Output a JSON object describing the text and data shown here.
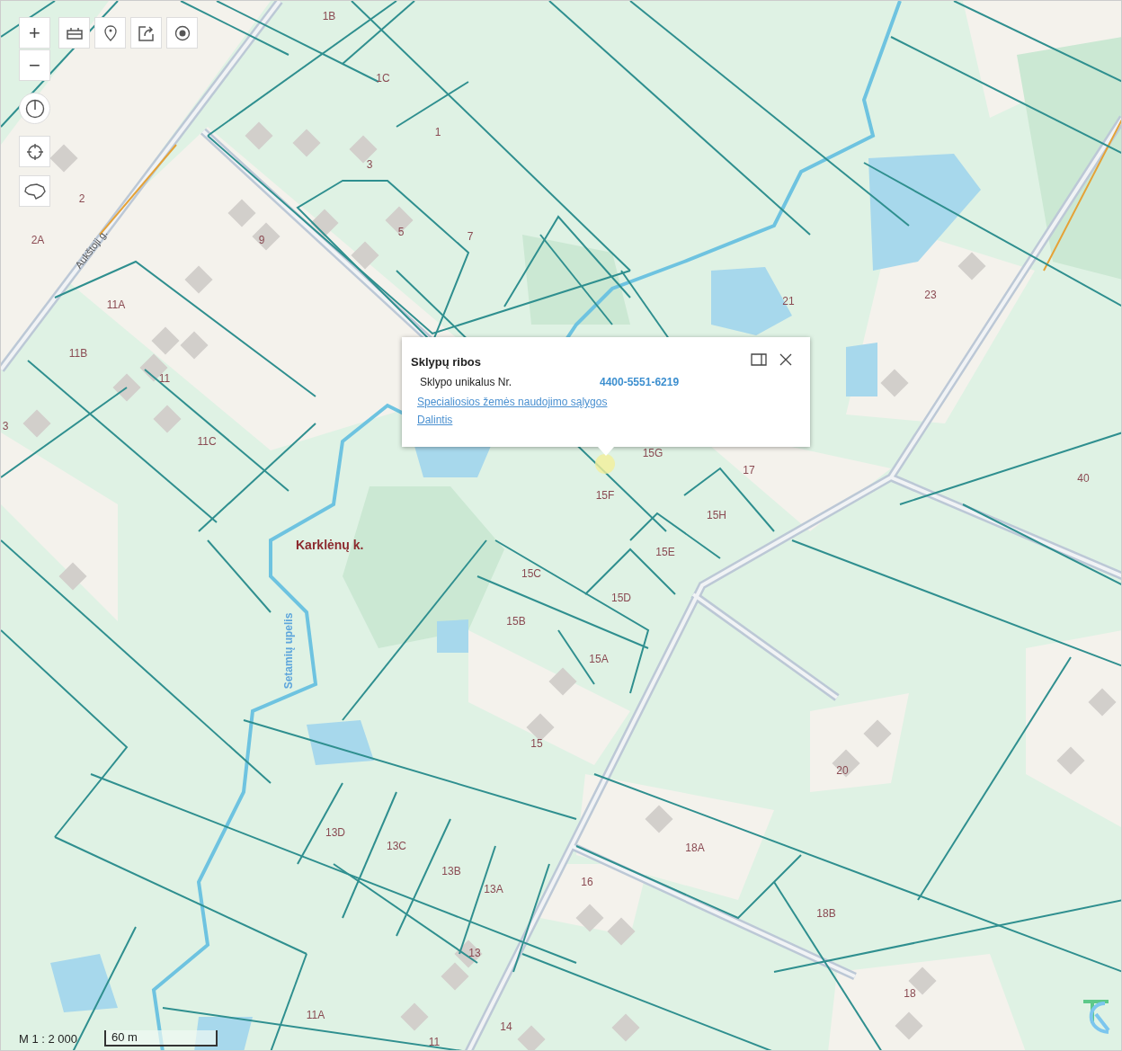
{
  "toolbar": [
    {
      "kind": "zoom-in",
      "label": "+"
    },
    {
      "kind": "zoom-out",
      "label": "−"
    },
    {
      "kind": "layers"
    },
    {
      "kind": "pin"
    },
    {
      "kind": "share"
    },
    {
      "kind": "target"
    },
    {
      "kind": "compass"
    },
    {
      "kind": "crosshair"
    },
    {
      "kind": "outline"
    }
  ],
  "map": {
    "place_name": "Karklėnų k.",
    "stream_name": "Setamių upelis",
    "street_name": "Aukštoji g.",
    "parcel_labels": [
      "1B",
      "1C",
      "1",
      "3",
      "2",
      "2A",
      "9",
      "5",
      "7",
      "11A",
      "11B",
      "11",
      "11C",
      "3",
      "21",
      "23",
      "15G",
      "17",
      "40",
      "15F",
      "15H",
      "15E",
      "15C",
      "15D",
      "15B",
      "15A",
      "15",
      "20",
      "13D",
      "13C",
      "13B",
      "13A",
      "16",
      "18A",
      "18B",
      "13",
      "18",
      "11A",
      "14",
      "11"
    ]
  },
  "popup": {
    "title": "Sklypų ribos",
    "field_label": "Sklypo unikalus Nr.",
    "field_value": "4400-5551-6219",
    "links": [
      "Specialiosios žemės naudojimo sąlygos",
      "Dalintis"
    ]
  },
  "scale": {
    "ratio": "M 1 : 2 000",
    "bar_label": "60 m"
  }
}
